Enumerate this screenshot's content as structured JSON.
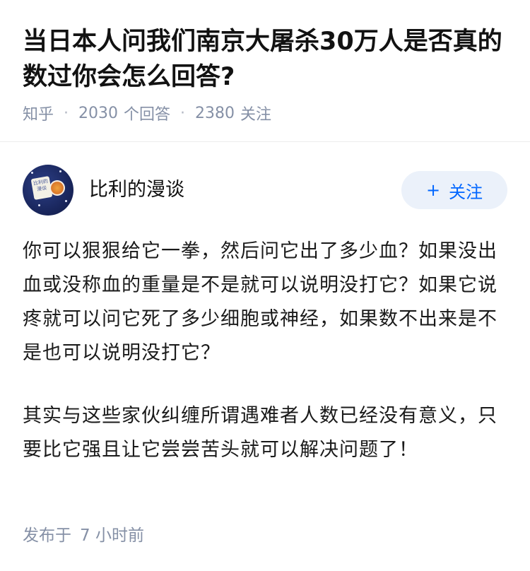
{
  "question": {
    "title": "当日本人问我们南京大屠杀30万人是否真的数过你会怎么回答?",
    "source": "知乎",
    "answer_count": "2030",
    "answer_label": "个回答",
    "follower_count": "2380",
    "follower_label": "关注"
  },
  "author": {
    "name": "比利的漫谈",
    "avatar_text": "比利的漫谈",
    "follow_button_label": "关注",
    "follow_button_icon": "plus-icon"
  },
  "answer": {
    "paragraphs": [
      "你可以狠狠给它一拳，然后问它出了多少血？如果没出血或没称血的重量是不是就可以说明没打它？如果它说疼就可以问它死了多少细胞或神经，如果数不出来是不是也可以说明没打它？",
      "其实与这些家伙纠缠所谓遇难者人数已经没有意义，只要比它强且让它尝尝苦头就可以解决问题了！"
    ],
    "published_label": "发布于",
    "published_time": "7 小时前"
  },
  "colors": {
    "meta_gray": "#8590a6",
    "brand_blue": "#0066ff",
    "follow_bg": "#ebf1fa",
    "title_text": "#121212"
  }
}
